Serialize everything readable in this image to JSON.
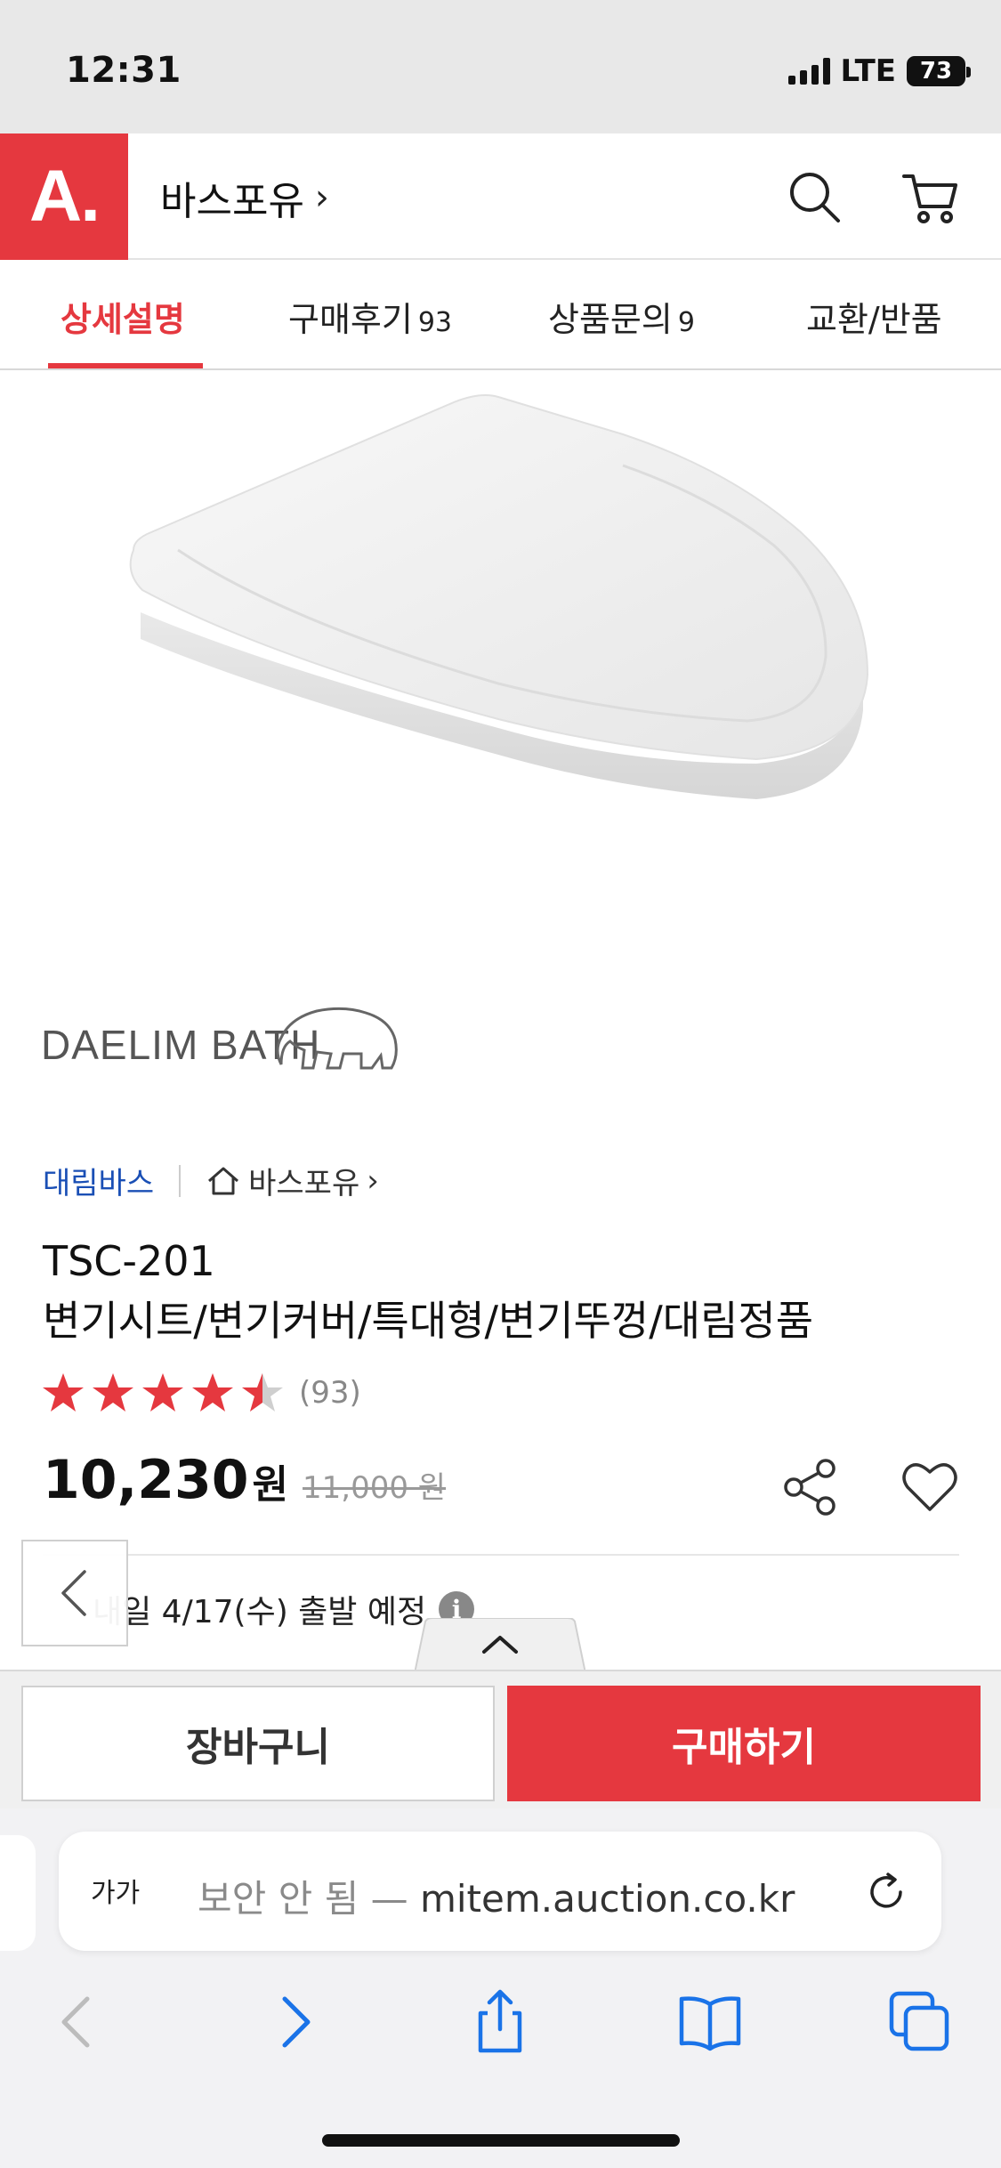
{
  "status": {
    "time": "12:31",
    "network": "LTE",
    "battery": "73"
  },
  "header": {
    "logo": "A.",
    "store_name": "바스포유",
    "chevron": "›"
  },
  "tabs": [
    {
      "label": "상세설명",
      "count": ""
    },
    {
      "label": "구매후기",
      "count": "93"
    },
    {
      "label": "상품문의",
      "count": "9"
    },
    {
      "label": "교환/반품",
      "count": ""
    }
  ],
  "brand_logo": {
    "text": "DAELIM BATH"
  },
  "product": {
    "brand": "대림바스",
    "store": "바스포유",
    "title_line1": "TSC-201",
    "title_line2": "변기시트/변기커버/특대형/변기뚜껑/대림정품",
    "rating": 4.5,
    "review_count": "(93)",
    "price": "10,230",
    "price_unit": "원",
    "original_price": "11,000 원",
    "shipping": "내일 4/17(수) 출발 예정",
    "info_icon": "i"
  },
  "actions": {
    "cart": "장바구니",
    "buy": "구매하기"
  },
  "browser": {
    "aa_label": "가가",
    "url_prefix": "보안 안 됨 — ",
    "url_host": "mitem.auction.co.kr"
  },
  "colors": {
    "brand_red": "#e5383f",
    "link_blue": "#1a4fb5",
    "star_red": "#e5383f"
  },
  "icons": [
    "search-icon",
    "cart-icon",
    "home-icon",
    "star-icon",
    "share-icon",
    "heart-icon",
    "chevron-left-icon",
    "chevron-up-icon",
    "reload-icon",
    "back-icon",
    "forward-icon",
    "share-sheet-icon",
    "bookmarks-icon",
    "tabs-icon"
  ]
}
